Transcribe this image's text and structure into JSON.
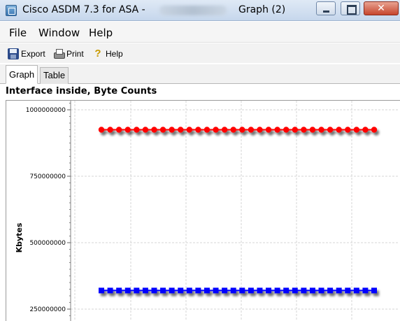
{
  "window": {
    "title_prefix": "Cisco ASDM 7.3 for ASA - ",
    "title_suffix": "Graph (2)",
    "close_label": "✕"
  },
  "menu": [
    {
      "label": "File"
    },
    {
      "label": "Window"
    },
    {
      "label": "Help"
    }
  ],
  "toolbar": {
    "export_label": "Export",
    "print_label": "Print",
    "help_label": "Help"
  },
  "tabs": [
    {
      "label": "Graph",
      "active": true
    },
    {
      "label": "Table",
      "active": false
    }
  ],
  "content": {
    "heading": "Interface inside, Byte Counts"
  },
  "chart_data": {
    "type": "line",
    "ylabel": "Kbytes",
    "xlabel": "",
    "title": "",
    "yticks": [
      1000000000,
      750000000,
      500000000,
      250000000
    ],
    "ytick_labels": [
      "1000000000",
      "750000000",
      "500000000",
      "250000000"
    ],
    "grid": true,
    "x_count": 32,
    "series": [
      {
        "color": "#ff0000",
        "marker": "circle",
        "values": [
          925000000,
          925000000,
          925000000,
          925000000,
          925000000,
          925000000,
          925000000,
          925000000,
          925000000,
          925000000,
          925000000,
          925000000,
          925000000,
          925000000,
          925000000,
          925000000,
          925000000,
          925000000,
          925000000,
          925000000,
          925000000,
          925000000,
          925000000,
          925000000,
          925000000,
          925000000,
          925000000,
          925000000,
          925000000,
          925000000,
          925000000,
          925000000
        ]
      },
      {
        "color": "#0000ff",
        "marker": "square",
        "values": [
          320000000,
          320000000,
          320000000,
          320000000,
          320000000,
          320000000,
          320000000,
          320000000,
          320000000,
          320000000,
          320000000,
          320000000,
          320000000,
          320000000,
          320000000,
          320000000,
          320000000,
          320000000,
          320000000,
          320000000,
          320000000,
          320000000,
          320000000,
          320000000,
          320000000,
          320000000,
          320000000,
          320000000,
          320000000,
          320000000,
          320000000,
          320000000
        ]
      }
    ]
  }
}
